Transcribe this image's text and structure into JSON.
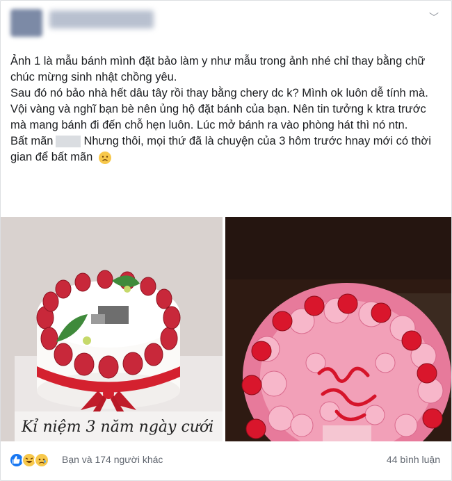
{
  "post": {
    "lines": [
      "Ảnh 1 là mẫu bánh mình đặt bảo làm y như mẫu trong ảnh nhé chỉ thay bằng chữ chúc mừng sinh nhật chồng yêu.",
      "Sau đó nó bảo nhà hết dâu tây rồi thay bằng chery dc k? Mình ok luôn dễ tính mà.",
      "Vội vàng và nghĩ bạn bè nên ủng hộ đặt bánh của bạn. Nên tin tưởng k ktra trước mà mang bánh đi đến chỗ hẹn luôn. Lúc mở bánh ra vào phòng hát thì nó ntn."
    ],
    "last_line_before": "Bất mãn",
    "last_line_after": "Nhưng thôi, mọi thứ đã là chuyện của 3 hôm trước hnay mới có thời gian để bất mãn",
    "emoji": "sad-face"
  },
  "photo1": {
    "caption": "Kỉ niệm 3 năm ngày cưới"
  },
  "footer": {
    "reactions_text": "Bạn và 174 người khác",
    "comments_text": "44 bình luận",
    "reaction_icons": [
      "like-icon",
      "haha-icon",
      "sad-icon"
    ]
  },
  "colors": {
    "like": "#1877f2",
    "haha": "#f7c84b",
    "strawberry": "#c8283a",
    "cream_pink": "#f2a0b8"
  }
}
